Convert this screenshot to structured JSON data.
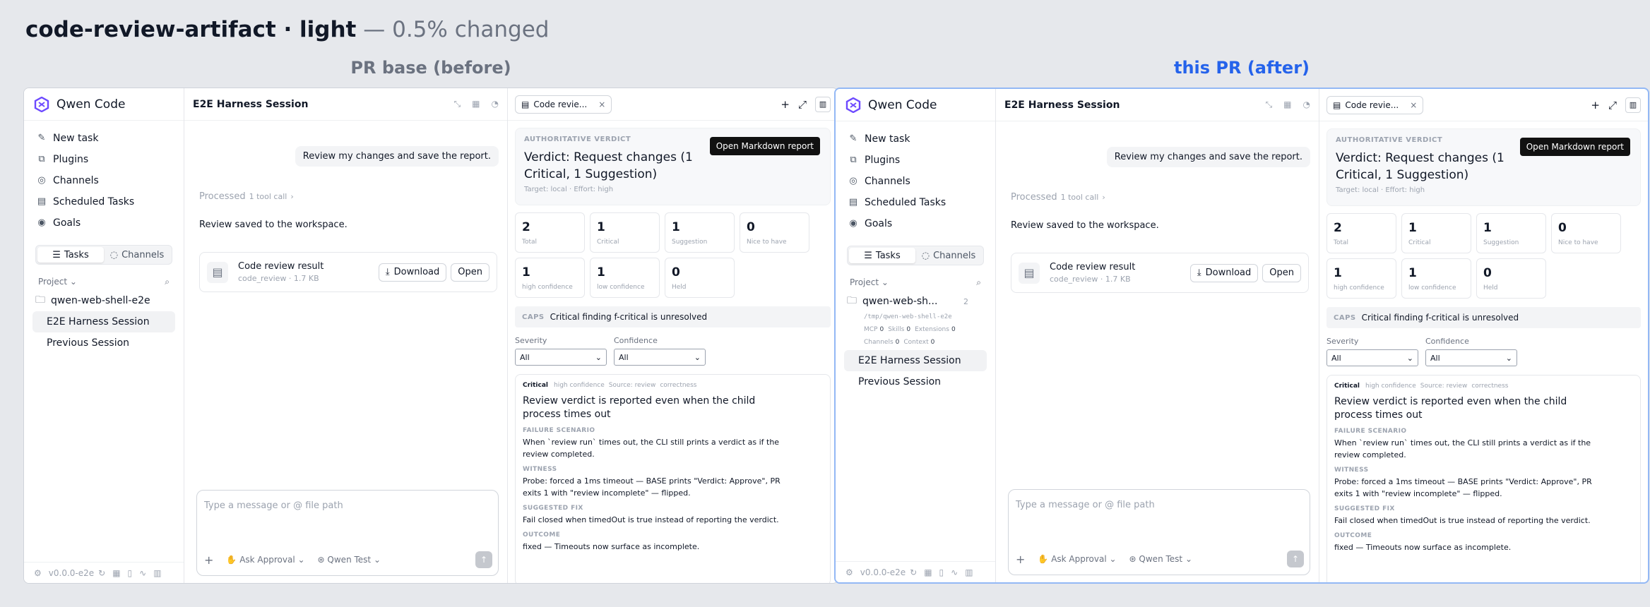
{
  "heading": {
    "title": "code-review-artifact · light",
    "suffix": " — 0.5% changed"
  },
  "columns": {
    "before": "PR base (before)",
    "after": "this PR (after)"
  },
  "app": {
    "name": "Qwen Code",
    "version": "v0.0.0-e2e"
  },
  "nav": [
    "New task",
    "Plugins",
    "Channels",
    "Scheduled Tasks",
    "Goals"
  ],
  "segment": {
    "tasks": "Tasks",
    "channels": "Channels"
  },
  "project": {
    "label": "Project",
    "folder": "qwen-web-shell-e2e",
    "folder_short": "qwen-web-sh...",
    "count": "2",
    "path": "/tmp/qwen-web-shell-e2e",
    "chips": [
      {
        "k": "MCP",
        "v": "0"
      },
      {
        "k": "Skills",
        "v": "0"
      },
      {
        "k": "Extensions",
        "v": "0"
      },
      {
        "k": "Channels",
        "v": "0"
      },
      {
        "k": "Context",
        "v": "0"
      }
    ]
  },
  "sessions": [
    "E2E Harness Session",
    "Previous Session"
  ],
  "chat": {
    "title": "E2E Harness Session",
    "user_message": "Review my changes and save the report.",
    "processed": "Processed",
    "tool_calls": "1 tool call",
    "reply": "Review saved to the workspace.",
    "card_title": "Code review result",
    "card_sub": "code_review · 1.7 KB",
    "download": "Download",
    "open": "Open",
    "placeholder": "Type a message or @ file path",
    "approval": "Ask Approval",
    "model": "Qwen Test"
  },
  "panel": {
    "tab": "Code revie...",
    "verdict_label": "AUTHORITATIVE VERDICT",
    "verdict": "Verdict: Request changes (1 Critical, 1 Suggestion)",
    "target": "Target: local · Effort: high",
    "open_report": "Open Markdown report",
    "stats": [
      {
        "n": "2",
        "c": "Total"
      },
      {
        "n": "1",
        "c": "Critical"
      },
      {
        "n": "1",
        "c": "Suggestion"
      },
      {
        "n": "0",
        "c": "Nice to have"
      },
      {
        "n": "1",
        "c": "high confidence"
      },
      {
        "n": "1",
        "c": "low confidence"
      },
      {
        "n": "0",
        "c": "Held"
      }
    ],
    "caps_key": "CAPS",
    "caps_text": "Critical finding f-critical is unresolved",
    "severity_label": "Severity",
    "confidence_label": "Confidence",
    "filter_value": "All",
    "finding": {
      "severity": "Critical",
      "confidence": "high confidence",
      "source": "Source: review",
      "category": "correctness",
      "title": "Review verdict is reported even when the child process times out",
      "h1": "FAILURE SCENARIO",
      "b1": "When `review run` times out, the CLI still prints a verdict as if the review completed.",
      "h2": "WITNESS",
      "b2": "Probe: forced a 1ms timeout — BASE prints \"Verdict: Approve\", PR exits 1 with \"review incomplete\" — flipped.",
      "h3": "SUGGESTED FIX",
      "b3": "Fail closed when timedOut is true instead of reporting the verdict.",
      "h4": "OUTCOME",
      "b4": "fixed — Timeouts now surface as incomplete."
    }
  }
}
